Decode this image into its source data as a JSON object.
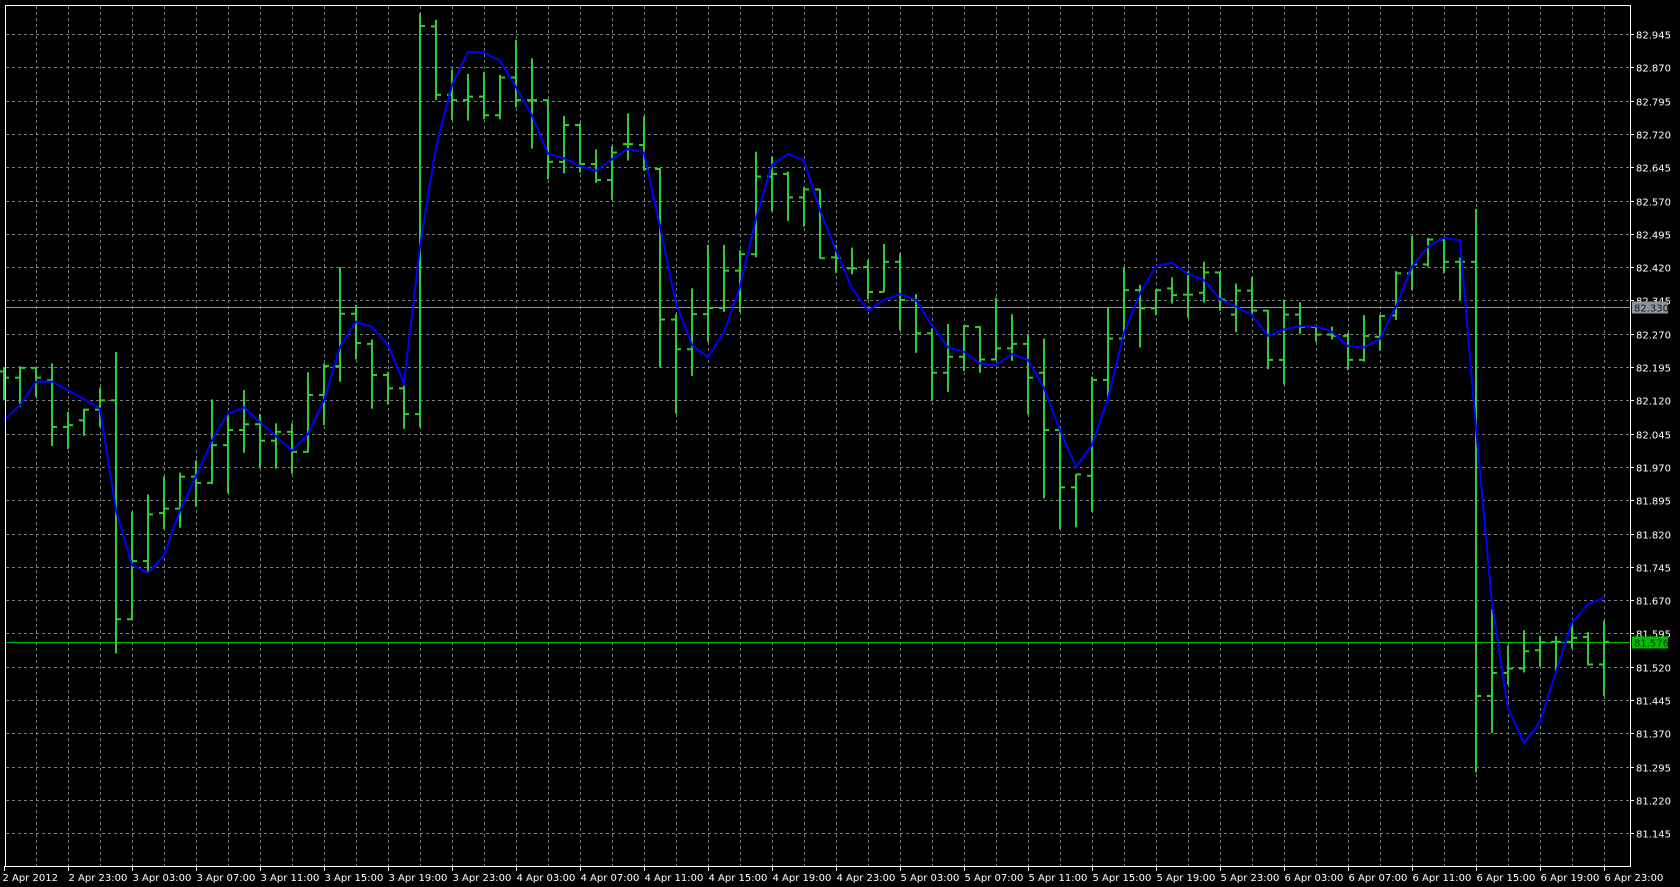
{
  "chart_data": {
    "type": "ohlc",
    "title": "",
    "timeframe_hours": 1,
    "colors": {
      "background": "#000000",
      "bars": "#32cd32",
      "ma_line": "#0000ff",
      "grid": "#7a7a7a",
      "frame": "#ffffff",
      "bid_line": "#00c000",
      "level_line": "#8c96a0"
    },
    "y_ticks": [
      "82.945",
      "82.870",
      "82.795",
      "82.720",
      "82.645",
      "82.570",
      "82.495",
      "82.420",
      "82.345",
      "82.270",
      "82.195",
      "82.120",
      "82.045",
      "81.970",
      "81.895",
      "81.820",
      "81.745",
      "81.670",
      "81.595",
      "81.520",
      "81.445",
      "81.370",
      "81.295",
      "81.220",
      "81.145"
    ],
    "ylim": [
      81.145,
      82.945
    ],
    "x_ticks": [
      {
        "label": "2 Apr 2012",
        "bar": 0
      },
      {
        "label": "2 Apr 23:00",
        "bar": 4
      },
      {
        "label": "3 Apr 03:00",
        "bar": 8
      },
      {
        "label": "3 Apr 07:00",
        "bar": 12
      },
      {
        "label": "3 Apr 11:00",
        "bar": 16
      },
      {
        "label": "3 Apr 15:00",
        "bar": 20
      },
      {
        "label": "3 Apr 19:00",
        "bar": 24
      },
      {
        "label": "3 Apr 23:00",
        "bar": 28
      },
      {
        "label": "4 Apr 03:00",
        "bar": 32
      },
      {
        "label": "4 Apr 07:00",
        "bar": 36
      },
      {
        "label": "4 Apr 11:00",
        "bar": 40
      },
      {
        "label": "4 Apr 15:00",
        "bar": 44
      },
      {
        "label": "4 Apr 19:00",
        "bar": 48
      },
      {
        "label": "4 Apr 23:00",
        "bar": 52
      },
      {
        "label": "5 Apr 03:00",
        "bar": 56
      },
      {
        "label": "5 Apr 07:00",
        "bar": 60
      },
      {
        "label": "5 Apr 11:00",
        "bar": 64
      },
      {
        "label": "5 Apr 15:00",
        "bar": 68
      },
      {
        "label": "5 Apr 19:00",
        "bar": 72
      },
      {
        "label": "5 Apr 23:00",
        "bar": 76
      },
      {
        "label": "6 Apr 03:00",
        "bar": 80
      },
      {
        "label": "6 Apr 07:00",
        "bar": 84
      },
      {
        "label": "6 Apr 11:00",
        "bar": 88
      },
      {
        "label": "6 Apr 15:00",
        "bar": 92
      },
      {
        "label": "6 Apr 19:00",
        "bar": 96
      },
      {
        "label": "6 Apr 23:00",
        "bar": 100
      }
    ],
    "level_line": {
      "price": 82.33,
      "label": "82.330"
    },
    "bid_line": {
      "price": 81.576,
      "label": "81.576"
    },
    "ohlc": [
      [
        82.185,
        82.195,
        82.12,
        82.171
      ],
      [
        82.171,
        82.197,
        82.105,
        82.193
      ],
      [
        82.193,
        82.193,
        82.128,
        82.171
      ],
      [
        82.165,
        82.203,
        82.017,
        82.06
      ],
      [
        82.06,
        82.094,
        82.01,
        82.064
      ],
      [
        82.075,
        82.101,
        82.04,
        82.099
      ],
      [
        82.099,
        82.149,
        82.06,
        82.12
      ],
      [
        82.12,
        82.229,
        81.55,
        81.627
      ],
      [
        81.627,
        81.869,
        81.627,
        81.758
      ],
      [
        81.758,
        81.908,
        81.73,
        81.863
      ],
      [
        81.866,
        81.949,
        81.83,
        81.876
      ],
      [
        81.876,
        81.957,
        81.833,
        81.948
      ],
      [
        81.948,
        81.985,
        81.88,
        81.934
      ],
      [
        81.934,
        82.122,
        81.931,
        82.019
      ],
      [
        82.019,
        82.092,
        81.911,
        82.053
      ],
      [
        82.053,
        82.143,
        82.002,
        82.066
      ],
      [
        82.066,
        82.089,
        81.969,
        82.029
      ],
      [
        82.029,
        82.068,
        81.966,
        82.049
      ],
      [
        82.049,
        82.068,
        81.955,
        82.004
      ],
      [
        82.004,
        82.183,
        82.002,
        82.132
      ],
      [
        82.132,
        82.203,
        82.064,
        82.197
      ],
      [
        82.197,
        82.42,
        82.162,
        82.315
      ],
      [
        82.315,
        82.335,
        82.212,
        82.249
      ],
      [
        82.247,
        82.257,
        82.101,
        82.177
      ],
      [
        82.177,
        82.184,
        82.111,
        82.147
      ],
      [
        82.147,
        82.154,
        82.056,
        82.089
      ],
      [
        82.089,
        82.992,
        82.06,
        82.963
      ],
      [
        82.962,
        82.977,
        82.796,
        82.808
      ],
      [
        82.808,
        82.865,
        82.751,
        82.796
      ],
      [
        82.796,
        82.855,
        82.75,
        82.804
      ],
      [
        82.804,
        82.86,
        82.753,
        82.762
      ],
      [
        82.762,
        82.853,
        82.753,
        82.847
      ],
      [
        82.847,
        82.932,
        82.78,
        82.796
      ],
      [
        82.796,
        82.89,
        82.687,
        82.796
      ],
      [
        82.796,
        82.798,
        82.618,
        82.657
      ],
      [
        82.657,
        82.76,
        82.631,
        82.74
      ],
      [
        82.74,
        82.744,
        82.633,
        82.652
      ],
      [
        82.652,
        82.685,
        82.61,
        82.616
      ],
      [
        82.616,
        82.693,
        82.571,
        82.678
      ],
      [
        82.697,
        82.766,
        82.66,
        82.697
      ],
      [
        82.695,
        82.76,
        82.637,
        82.641
      ],
      [
        82.641,
        82.643,
        82.194,
        82.302
      ],
      [
        82.302,
        82.314,
        82.09,
        82.235
      ],
      [
        82.235,
        82.372,
        82.175,
        82.314
      ],
      [
        82.314,
        82.47,
        82.252,
        82.328
      ],
      [
        82.328,
        82.47,
        82.319,
        82.412
      ],
      [
        82.412,
        82.458,
        82.319,
        82.449
      ],
      [
        82.449,
        82.68,
        82.442,
        82.624
      ],
      [
        82.624,
        82.669,
        82.545,
        82.63
      ],
      [
        82.63,
        82.635,
        82.524,
        82.577
      ],
      [
        82.577,
        82.6,
        82.511,
        82.595
      ],
      [
        82.595,
        82.595,
        82.44,
        82.44
      ],
      [
        82.442,
        82.47,
        82.407,
        82.44
      ],
      [
        82.417,
        82.464,
        82.404,
        82.417
      ],
      [
        82.42,
        82.436,
        82.347,
        82.364
      ],
      [
        82.364,
        82.472,
        82.364,
        82.432
      ],
      [
        82.432,
        82.451,
        82.278,
        82.346
      ],
      [
        82.346,
        82.359,
        82.227,
        82.271
      ],
      [
        82.271,
        82.282,
        82.119,
        82.182
      ],
      [
        82.182,
        82.292,
        82.139,
        82.218
      ],
      [
        82.218,
        82.289,
        82.186,
        82.287
      ],
      [
        82.285,
        82.287,
        82.182,
        82.212
      ],
      [
        82.212,
        82.351,
        82.211,
        82.237
      ],
      [
        82.237,
        82.314,
        82.209,
        82.247
      ],
      [
        82.247,
        82.269,
        82.088,
        82.171
      ],
      [
        82.182,
        82.259,
        81.899,
        82.053
      ],
      [
        82.053,
        82.053,
        81.83,
        81.924
      ],
      [
        81.924,
        81.953,
        81.834,
        81.953
      ],
      [
        81.95,
        82.173,
        81.869,
        82.166
      ],
      [
        82.166,
        82.329,
        82.128,
        82.259
      ],
      [
        82.259,
        82.419,
        82.259,
        82.368
      ],
      [
        82.368,
        82.38,
        82.239,
        82.327
      ],
      [
        82.327,
        82.37,
        82.312,
        82.368
      ],
      [
        82.372,
        82.397,
        82.338,
        82.357
      ],
      [
        82.358,
        82.41,
        82.306,
        82.358
      ],
      [
        82.362,
        82.432,
        82.34,
        82.408
      ],
      [
        82.408,
        82.41,
        82.322,
        82.347
      ],
      [
        82.313,
        82.383,
        82.273,
        82.367
      ],
      [
        82.367,
        82.398,
        82.316,
        82.322
      ],
      [
        82.322,
        82.323,
        82.19,
        82.211
      ],
      [
        82.211,
        82.347,
        82.156,
        82.313
      ],
      [
        82.313,
        82.341,
        82.269,
        82.285
      ],
      [
        82.285,
        82.286,
        82.252,
        82.268
      ],
      [
        82.268,
        82.286,
        82.257,
        82.265
      ],
      [
        82.265,
        82.272,
        82.188,
        82.211
      ],
      [
        82.211,
        82.312,
        82.207,
        82.265
      ],
      [
        82.263,
        82.312,
        82.232,
        82.31
      ],
      [
        82.311,
        82.411,
        82.301,
        82.406
      ],
      [
        82.406,
        82.49,
        82.368,
        82.426
      ],
      [
        82.426,
        82.486,
        82.421,
        82.482
      ],
      [
        82.482,
        82.483,
        82.406,
        82.432
      ],
      [
        82.432,
        82.442,
        82.345,
        82.432
      ],
      [
        82.432,
        82.551,
        81.282,
        81.454
      ],
      [
        81.454,
        81.65,
        81.371,
        81.506
      ],
      [
        81.506,
        81.568,
        81.48,
        81.516
      ],
      [
        81.516,
        81.602,
        81.507,
        81.555
      ],
      [
        81.557,
        81.589,
        81.52,
        81.575
      ],
      [
        81.576,
        81.589,
        81.507,
        81.576
      ],
      [
        81.576,
        81.62,
        81.561,
        81.585
      ],
      [
        81.587,
        81.598,
        81.523,
        81.525
      ],
      [
        81.525,
        81.624,
        81.454,
        81.576
      ]
    ],
    "ma": [
      82.075,
      82.109,
      82.162,
      82.162,
      82.143,
      82.122,
      82.101,
      81.872,
      81.749,
      81.731,
      81.771,
      81.872,
      81.948,
      82.03,
      82.09,
      82.104,
      82.071,
      82.039,
      82.006,
      82.044,
      82.12,
      82.24,
      82.297,
      82.285,
      82.244,
      82.158,
      82.466,
      82.691,
      82.83,
      82.905,
      82.903,
      82.885,
      82.825,
      82.762,
      82.675,
      82.665,
      82.648,
      82.637,
      82.663,
      82.686,
      82.678,
      82.511,
      82.338,
      82.244,
      82.217,
      82.274,
      82.376,
      82.53,
      82.65,
      82.675,
      82.66,
      82.548,
      82.458,
      82.372,
      82.322,
      82.346,
      82.359,
      82.346,
      82.289,
      82.239,
      82.229,
      82.203,
      82.199,
      82.224,
      82.211,
      82.147,
      82.053,
      81.97,
      82.019,
      82.124,
      82.271,
      82.361,
      82.422,
      82.43,
      82.404,
      82.391,
      82.347,
      82.331,
      82.312,
      82.265,
      82.28,
      82.287,
      82.287,
      82.274,
      82.242,
      82.239,
      82.259,
      82.331,
      82.421,
      82.466,
      82.486,
      82.48,
      82.059,
      81.663,
      81.426,
      81.348,
      81.396,
      81.508,
      81.62,
      81.661,
      81.675
    ]
  }
}
